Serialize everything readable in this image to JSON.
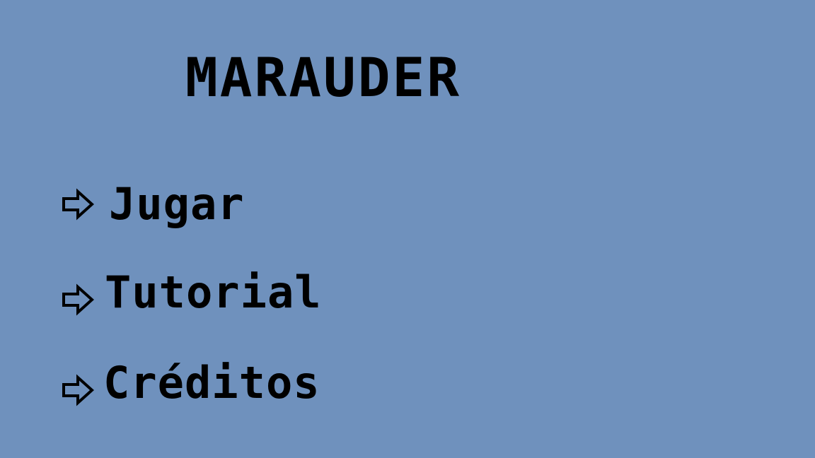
{
  "game": {
    "title": "MARAUDER"
  },
  "menu": {
    "items": [
      {
        "label": "Jugar",
        "icon": "right-arrow-icon"
      },
      {
        "label": "Tutorial",
        "icon": "right-arrow-icon"
      },
      {
        "label": "Créditos",
        "icon": "right-arrow-icon"
      }
    ]
  },
  "colors": {
    "background": "#6f91bd",
    "text": "#000000"
  }
}
